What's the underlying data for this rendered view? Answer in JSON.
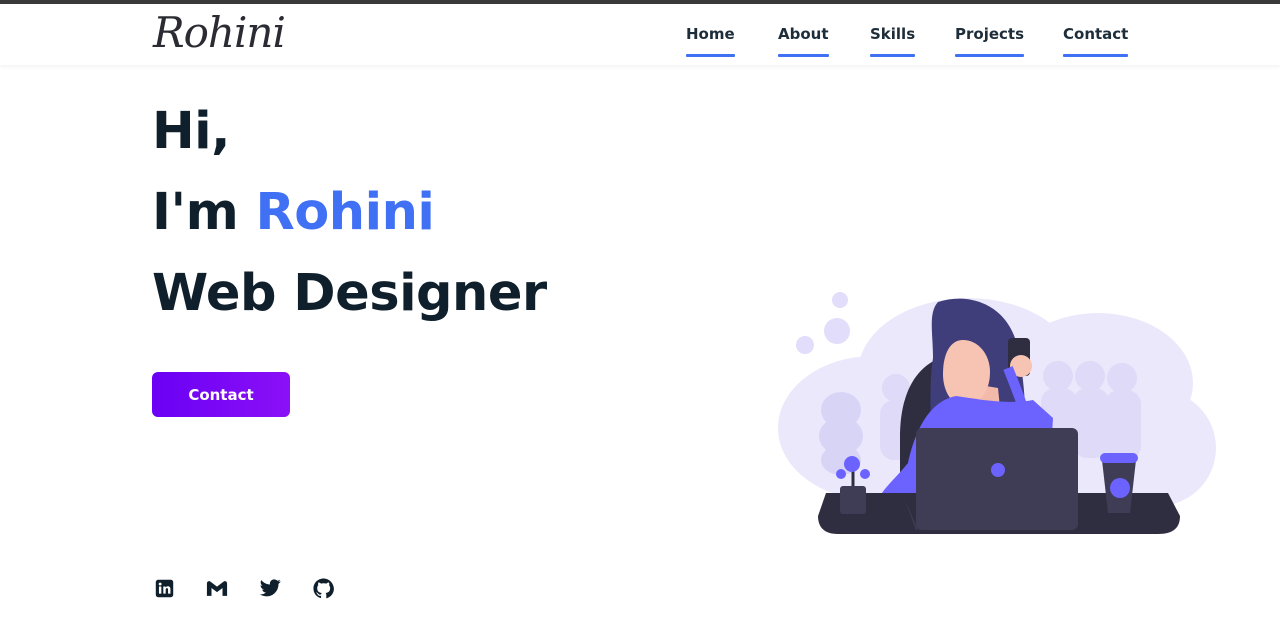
{
  "brand": {
    "logo_text": "Rohini"
  },
  "nav": {
    "items": [
      {
        "label": "Home"
      },
      {
        "label": "About"
      },
      {
        "label": "Skills"
      },
      {
        "label": "Projects"
      },
      {
        "label": "Contact"
      }
    ]
  },
  "hero": {
    "greeting": "Hi,",
    "intro_prefix": "I'm ",
    "name": "Rohini",
    "role": "Web Designer",
    "cta_label": "Contact"
  },
  "social": {
    "icons": [
      "linkedin-icon",
      "gmail-icon",
      "twitter-icon",
      "github-icon"
    ]
  },
  "colors": {
    "accent": "#4070f4",
    "button_gradient_start": "#6a00f4",
    "button_gradient_end": "#8b10f7",
    "heading": "#0f1f2b"
  }
}
